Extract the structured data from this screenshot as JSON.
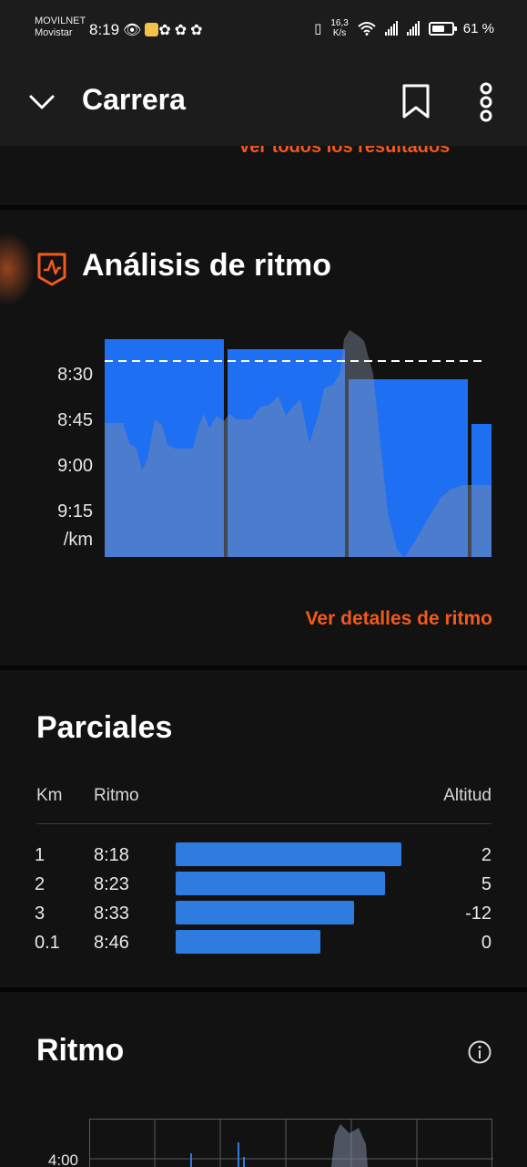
{
  "status_bar": {
    "carrier_1": "MOVILNET",
    "carrier_2": "Movistar",
    "time": "8:19",
    "net_speed_value": "16,3",
    "net_speed_unit": "K/s",
    "battery": "61 %",
    "battery_level": 0.61
  },
  "app_bar": {
    "title": "Carrera"
  },
  "results_link": "Ver todos los resultados",
  "pace_analysis": {
    "title": "Análisis de ritmo",
    "y_labels": [
      "8:30",
      "8:45",
      "9:00",
      "9:15",
      "/km"
    ],
    "details_link": "Ver detalles de ritmo"
  },
  "splits": {
    "title": "Parciales",
    "headers": {
      "km": "Km",
      "pace": "Ritmo",
      "elevation": "Altitud"
    },
    "rows": [
      {
        "km": "1",
        "pace": "8:18",
        "elevation": "2",
        "bar_fraction": 1.0
      },
      {
        "km": "2",
        "pace": "8:23",
        "elevation": "5",
        "bar_fraction": 0.928
      },
      {
        "km": "3",
        "pace": "8:33",
        "elevation": "-12",
        "bar_fraction": 0.79
      },
      {
        "km": "0.1",
        "pace": "8:46",
        "elevation": "0",
        "bar_fraction": 0.64
      }
    ],
    "bar_color": "#2f7ce0"
  },
  "pace_section": {
    "title": "Ritmo",
    "y_label": "4:00"
  },
  "colors": {
    "accent": "#f25a1d",
    "background": "#121212",
    "chart_blue": "#1f6ff2"
  },
  "chart_data": {
    "type": "bar",
    "categories": [
      "1",
      "2",
      "3",
      "0.1"
    ],
    "values": [
      "8:18",
      "8:23",
      "8:33",
      "8:46"
    ],
    "y_labels": [
      "8:30",
      "8:45",
      "9:00",
      "9:15"
    ],
    "ylabel": "/km",
    "average_line": "dashed"
  }
}
